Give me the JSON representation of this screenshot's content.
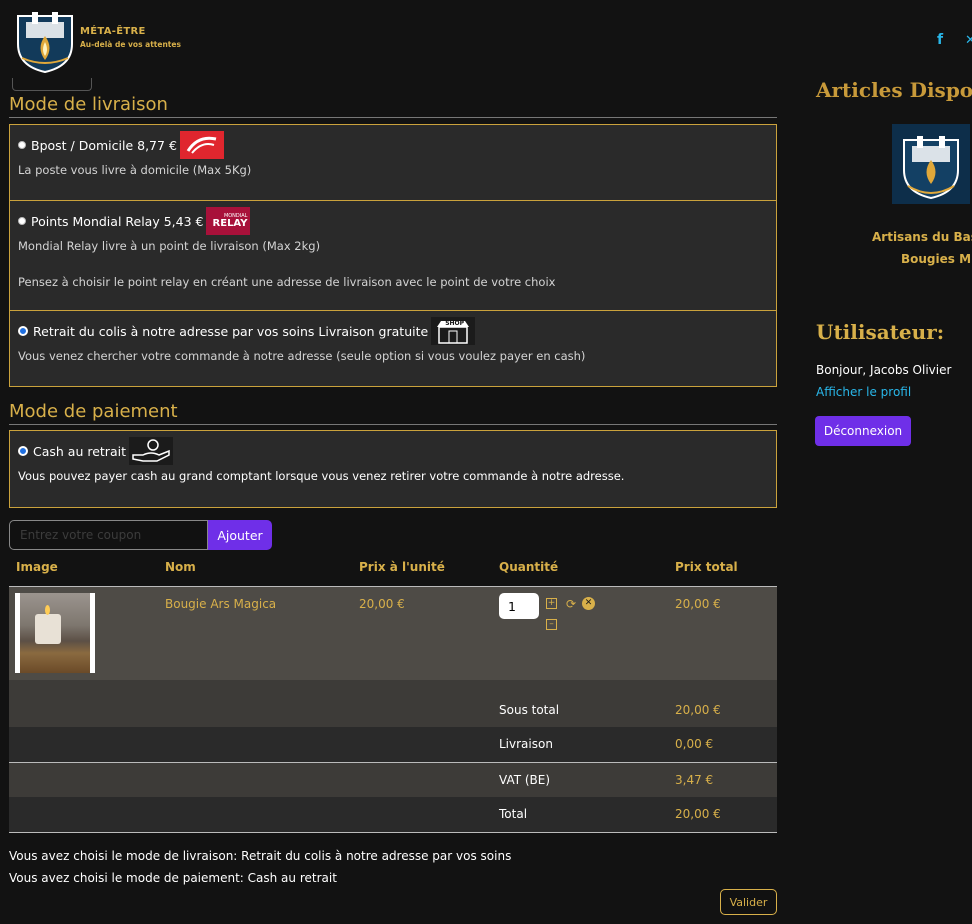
{
  "header": {
    "brand_name": "MÉTA-ÊTRE",
    "brand_tagline": "Au-delà de vos attentes",
    "social": [
      "facebook-icon",
      "x-icon"
    ]
  },
  "delivery": {
    "title": "Mode de livraison",
    "options": [
      {
        "label": "Bpost / Domicile 8,77 €",
        "desc": "La poste vous livre à domicile (Max 5Kg)",
        "selected": false
      },
      {
        "label": "Points Mondial Relay 5,43 €",
        "desc": "Mondial Relay livre à un point de livraison (Max 2kg)",
        "note": "Pensez à choisir le point relay en créant une adresse de livraison avec le point de votre choix",
        "selected": false
      },
      {
        "label": "Retrait du colis à notre adresse par vos soins Livraison gratuite",
        "desc": "Vous venez chercher votre commande à notre adresse (seule option si vous voulez payer en cash)",
        "selected": true
      }
    ],
    "relay_logo_small": "MONDIAL",
    "relay_logo_big": "RELAY",
    "shop_logo": "SHOP"
  },
  "payment": {
    "title": "Mode de paiement",
    "options": [
      {
        "label": "Cash au retrait",
        "desc": "Vous pouvez payer cash au grand comptant lorsque vous venez retirer votre commande à notre adresse.",
        "selected": true
      }
    ]
  },
  "coupon": {
    "placeholder": "Entrez votre coupon",
    "button": "Ajouter"
  },
  "cart": {
    "headers": {
      "image": "Image",
      "name": "Nom",
      "unit_price": "Prix à l'unité",
      "quantity": "Quantité",
      "total": "Prix total"
    },
    "items": [
      {
        "name": "Bougie Ars Magica",
        "unit_price": "20,00 €",
        "quantity": "1",
        "total": "20,00 €"
      }
    ],
    "summary": {
      "subtotal_label": "Sous total",
      "subtotal": "20,00 €",
      "delivery_label": "Livraison",
      "delivery": "0,00 €",
      "vat_label": "VAT (BE)",
      "vat": "3,47 €",
      "total_label": "Total",
      "total": "20,00 €"
    }
  },
  "info": {
    "delivery_choice": "Vous avez choisi le mode de livraison: Retrait du colis à notre adresse par vos soins",
    "payment_choice": "Vous avez choisi le mode de paiement: Cash au retrait",
    "validate": "Valider"
  },
  "sidebar": {
    "articles_title": "Articles Disponi",
    "product_line1": "Artisans du Bast",
    "product_line2": "Bougies MÉ",
    "user_title": "Utilisateur:",
    "greeting": "Bonjour, Jacobs Olivier",
    "profile_link": "Afficher le profil",
    "logout": "Déconnexion"
  },
  "colors": {
    "accent_gold": "#d8b04a",
    "button_purple": "#6f2fe8",
    "link_blue": "#29b6e8",
    "background": "#121212"
  }
}
